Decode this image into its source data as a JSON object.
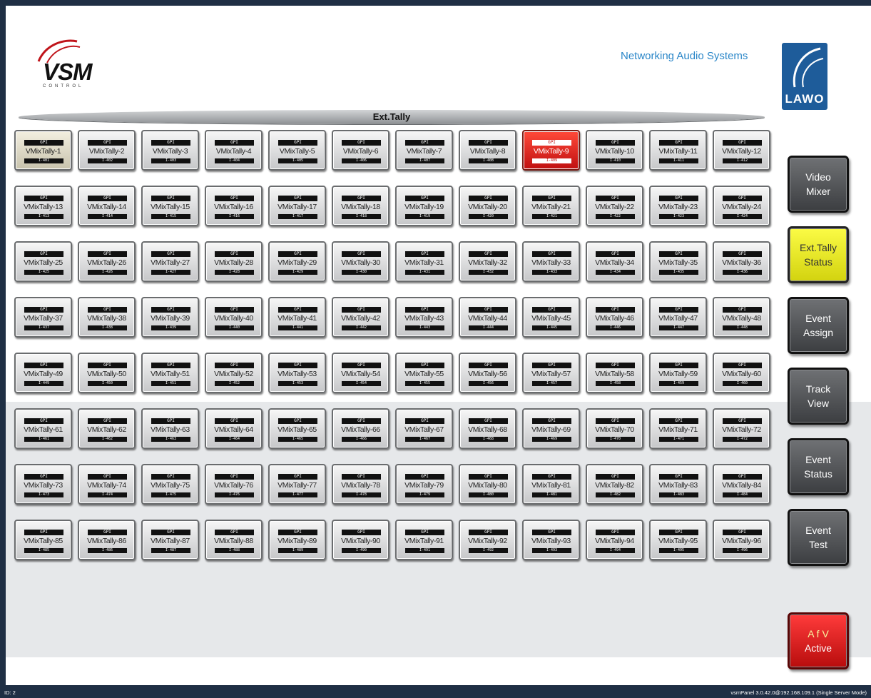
{
  "header": {
    "logo_vsm": "VSM",
    "logo_vsm_sub": "CONTROL",
    "tagline": "Networking Audio Systems",
    "logo_lawo": "LAWO"
  },
  "section_title": "Ext.Tally",
  "tiles": [
    {
      "label": "VMixTally-1",
      "code": "I-401",
      "state": "selected"
    },
    {
      "label": "VMixTally-2",
      "code": "I-402",
      "state": "normal"
    },
    {
      "label": "VMixTally-3",
      "code": "I-403",
      "state": "normal"
    },
    {
      "label": "VMixTally-4",
      "code": "I-404",
      "state": "normal"
    },
    {
      "label": "VMixTally-5",
      "code": "I-405",
      "state": "normal"
    },
    {
      "label": "VMixTally-6",
      "code": "I-406",
      "state": "normal"
    },
    {
      "label": "VMixTally-7",
      "code": "I-407",
      "state": "normal"
    },
    {
      "label": "VMixTally-8",
      "code": "I-408",
      "state": "normal"
    },
    {
      "label": "VMixTally-9",
      "code": "I-409",
      "state": "active"
    },
    {
      "label": "VMixTally-10",
      "code": "I-410",
      "state": "normal"
    },
    {
      "label": "VMixTally-11",
      "code": "I-411",
      "state": "normal"
    },
    {
      "label": "VMixTally-12",
      "code": "I-412",
      "state": "normal"
    },
    {
      "label": "VMixTally-13",
      "code": "I-413",
      "state": "normal"
    },
    {
      "label": "VMixTally-14",
      "code": "I-414",
      "state": "normal"
    },
    {
      "label": "VMixTally-15",
      "code": "I-415",
      "state": "normal"
    },
    {
      "label": "VMixTally-16",
      "code": "I-416",
      "state": "normal"
    },
    {
      "label": "VMixTally-17",
      "code": "I-417",
      "state": "normal"
    },
    {
      "label": "VMixTally-18",
      "code": "I-418",
      "state": "normal"
    },
    {
      "label": "VMixTally-19",
      "code": "I-419",
      "state": "normal"
    },
    {
      "label": "VMixTally-20",
      "code": "I-420",
      "state": "normal"
    },
    {
      "label": "VMixTally-21",
      "code": "I-421",
      "state": "normal"
    },
    {
      "label": "VMixTally-22",
      "code": "I-422",
      "state": "normal"
    },
    {
      "label": "VMixTally-23",
      "code": "I-423",
      "state": "normal"
    },
    {
      "label": "VMixTally-24",
      "code": "I-424",
      "state": "normal"
    },
    {
      "label": "VMixTally-25",
      "code": "I-425",
      "state": "normal"
    },
    {
      "label": "VMixTally-26",
      "code": "I-426",
      "state": "normal"
    },
    {
      "label": "VMixTally-27",
      "code": "I-427",
      "state": "normal"
    },
    {
      "label": "VMixTally-28",
      "code": "I-428",
      "state": "normal"
    },
    {
      "label": "VMixTally-29",
      "code": "I-429",
      "state": "normal"
    },
    {
      "label": "VMixTally-30",
      "code": "I-430",
      "state": "normal"
    },
    {
      "label": "VMixTally-31",
      "code": "I-431",
      "state": "normal"
    },
    {
      "label": "VMixTally-32",
      "code": "I-432",
      "state": "normal"
    },
    {
      "label": "VMixTally-33",
      "code": "I-433",
      "state": "normal"
    },
    {
      "label": "VMixTally-34",
      "code": "I-434",
      "state": "normal"
    },
    {
      "label": "VMixTally-35",
      "code": "I-435",
      "state": "normal"
    },
    {
      "label": "VMixTally-36",
      "code": "I-436",
      "state": "normal"
    },
    {
      "label": "VMixTally-37",
      "code": "I-437",
      "state": "normal"
    },
    {
      "label": "VMixTally-38",
      "code": "I-438",
      "state": "normal"
    },
    {
      "label": "VMixTally-39",
      "code": "I-439",
      "state": "normal"
    },
    {
      "label": "VMixTally-40",
      "code": "I-440",
      "state": "normal"
    },
    {
      "label": "VMixTally-41",
      "code": "I-441",
      "state": "normal"
    },
    {
      "label": "VMixTally-42",
      "code": "I-442",
      "state": "normal"
    },
    {
      "label": "VMixTally-43",
      "code": "I-443",
      "state": "normal"
    },
    {
      "label": "VMixTally-44",
      "code": "I-444",
      "state": "normal"
    },
    {
      "label": "VMixTally-45",
      "code": "I-445",
      "state": "normal"
    },
    {
      "label": "VMixTally-46",
      "code": "I-446",
      "state": "normal"
    },
    {
      "label": "VMixTally-47",
      "code": "I-447",
      "state": "normal"
    },
    {
      "label": "VMixTally-48",
      "code": "I-448",
      "state": "normal"
    },
    {
      "label": "VMixTally-49",
      "code": "I-449",
      "state": "normal"
    },
    {
      "label": "VMixTally-50",
      "code": "I-450",
      "state": "normal"
    },
    {
      "label": "VMixTally-51",
      "code": "I-451",
      "state": "normal"
    },
    {
      "label": "VMixTally-52",
      "code": "I-452",
      "state": "normal"
    },
    {
      "label": "VMixTally-53",
      "code": "I-453",
      "state": "normal"
    },
    {
      "label": "VMixTally-54",
      "code": "I-454",
      "state": "normal"
    },
    {
      "label": "VMixTally-55",
      "code": "I-455",
      "state": "normal"
    },
    {
      "label": "VMixTally-56",
      "code": "I-456",
      "state": "normal"
    },
    {
      "label": "VMixTally-57",
      "code": "I-457",
      "state": "normal"
    },
    {
      "label": "VMixTally-58",
      "code": "I-458",
      "state": "normal"
    },
    {
      "label": "VMixTally-59",
      "code": "I-459",
      "state": "normal"
    },
    {
      "label": "VMixTally-60",
      "code": "I-460",
      "state": "normal"
    },
    {
      "label": "VMixTally-61",
      "code": "I-461",
      "state": "normal"
    },
    {
      "label": "VMixTally-62",
      "code": "I-462",
      "state": "normal"
    },
    {
      "label": "VMixTally-63",
      "code": "I-463",
      "state": "normal"
    },
    {
      "label": "VMixTally-64",
      "code": "I-464",
      "state": "normal"
    },
    {
      "label": "VMixTally-65",
      "code": "I-465",
      "state": "normal"
    },
    {
      "label": "VMixTally-66",
      "code": "I-466",
      "state": "normal"
    },
    {
      "label": "VMixTally-67",
      "code": "I-467",
      "state": "normal"
    },
    {
      "label": "VMixTally-68",
      "code": "I-468",
      "state": "normal"
    },
    {
      "label": "VMixTally-69",
      "code": "I-469",
      "state": "normal"
    },
    {
      "label": "VMixTally-70",
      "code": "I-470",
      "state": "normal"
    },
    {
      "label": "VMixTally-71",
      "code": "I-471",
      "state": "normal"
    },
    {
      "label": "VMixTally-72",
      "code": "I-472",
      "state": "normal"
    },
    {
      "label": "VMixTally-73",
      "code": "I-473",
      "state": "normal"
    },
    {
      "label": "VMixTally-74",
      "code": "I-474",
      "state": "normal"
    },
    {
      "label": "VMixTally-75",
      "code": "I-475",
      "state": "normal"
    },
    {
      "label": "VMixTally-76",
      "code": "I-476",
      "state": "normal"
    },
    {
      "label": "VMixTally-77",
      "code": "I-477",
      "state": "normal"
    },
    {
      "label": "VMixTally-78",
      "code": "I-478",
      "state": "normal"
    },
    {
      "label": "VMixTally-79",
      "code": "I-479",
      "state": "normal"
    },
    {
      "label": "VMixTally-80",
      "code": "I-480",
      "state": "normal"
    },
    {
      "label": "VMixTally-81",
      "code": "I-481",
      "state": "normal"
    },
    {
      "label": "VMixTally-82",
      "code": "I-482",
      "state": "normal"
    },
    {
      "label": "VMixTally-83",
      "code": "I-483",
      "state": "normal"
    },
    {
      "label": "VMixTally-84",
      "code": "I-484",
      "state": "normal"
    },
    {
      "label": "VMixTally-85",
      "code": "I-485",
      "state": "normal"
    },
    {
      "label": "VMixTally-86",
      "code": "I-486",
      "state": "normal"
    },
    {
      "label": "VMixTally-87",
      "code": "I-487",
      "state": "normal"
    },
    {
      "label": "VMixTally-88",
      "code": "I-488",
      "state": "normal"
    },
    {
      "label": "VMixTally-89",
      "code": "I-489",
      "state": "normal"
    },
    {
      "label": "VMixTally-90",
      "code": "I-490",
      "state": "normal"
    },
    {
      "label": "VMixTally-91",
      "code": "I-491",
      "state": "normal"
    },
    {
      "label": "VMixTally-92",
      "code": "I-492",
      "state": "normal"
    },
    {
      "label": "VMixTally-93",
      "code": "I-493",
      "state": "normal"
    },
    {
      "label": "VMixTally-94",
      "code": "I-494",
      "state": "normal"
    },
    {
      "label": "VMixTally-95",
      "code": "I-495",
      "state": "normal"
    },
    {
      "label": "VMixTally-96",
      "code": "I-496",
      "state": "normal"
    }
  ],
  "tile_gpi_label": "GPI",
  "sidebar": {
    "video_mixer": "Video\nMixer",
    "ext_tally_status": "Ext.Tally\nStatus",
    "event_assign": "Event\nAssign",
    "track_view": "Track\nView",
    "event_status": "Event\nStatus",
    "event_test": "Event\nTest",
    "afv_line1": "A f V",
    "afv_line2": "Active"
  },
  "colors": {
    "selected_button": "#e8e82a",
    "alert_button": "#e41c1c",
    "brand_blue": "#2a86c8"
  },
  "status_bar": {
    "left": "ID: 2",
    "right": "vsmPanel 3.0.42.0@192.168.109.1 (Single Server Mode)"
  }
}
